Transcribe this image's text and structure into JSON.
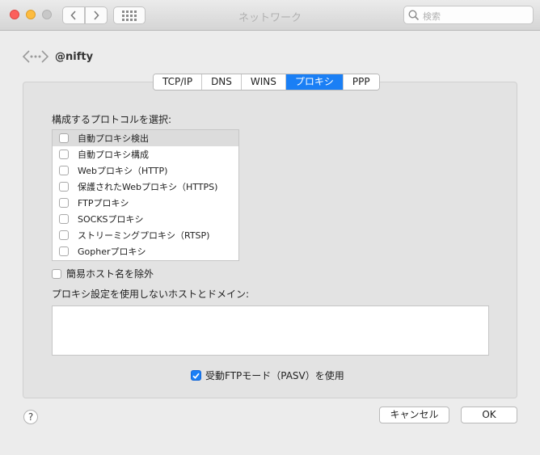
{
  "window": {
    "title": "ネットワーク",
    "search_placeholder": "検索"
  },
  "connection": {
    "name": "@nifty",
    "icon": "network-dots-icon"
  },
  "tabs": [
    {
      "label": "TCP/IP",
      "active": false
    },
    {
      "label": "DNS",
      "active": false
    },
    {
      "label": "WINS",
      "active": false
    },
    {
      "label": "プロキシ",
      "active": true
    },
    {
      "label": "PPP",
      "active": false
    }
  ],
  "proxy": {
    "protocol_label": "構成するプロトコルを選択:",
    "protocols": [
      {
        "label": "自動プロキシ検出",
        "checked": false,
        "selected": true
      },
      {
        "label": "自動プロキシ構成",
        "checked": false,
        "selected": false
      },
      {
        "label": "Webプロキシ（HTTP)",
        "checked": false,
        "selected": false
      },
      {
        "label": "保護されたWebプロキシ（HTTPS)",
        "checked": false,
        "selected": false
      },
      {
        "label": "FTPプロキシ",
        "checked": false,
        "selected": false
      },
      {
        "label": "SOCKSプロキシ",
        "checked": false,
        "selected": false
      },
      {
        "label": "ストリーミングプロキシ（RTSP)",
        "checked": false,
        "selected": false
      },
      {
        "label": "Gopherプロキシ",
        "checked": false,
        "selected": false
      }
    ],
    "exclude_simple_hostnames": {
      "label": "簡易ホスト名を除外",
      "checked": false
    },
    "bypass_label": "プロキシ設定を使用しないホストとドメイン:",
    "bypass_value": "",
    "passive_ftp": {
      "label": "受動FTPモード（PASV）を使用",
      "checked": true
    }
  },
  "footer": {
    "help_label": "?",
    "cancel_label": "キャンセル",
    "ok_label": "OK"
  },
  "colors": {
    "accent": "#1a7ff5",
    "close": "#fc605c",
    "minimize": "#fdbc40",
    "zoom_disabled": "#c8c8c8"
  }
}
